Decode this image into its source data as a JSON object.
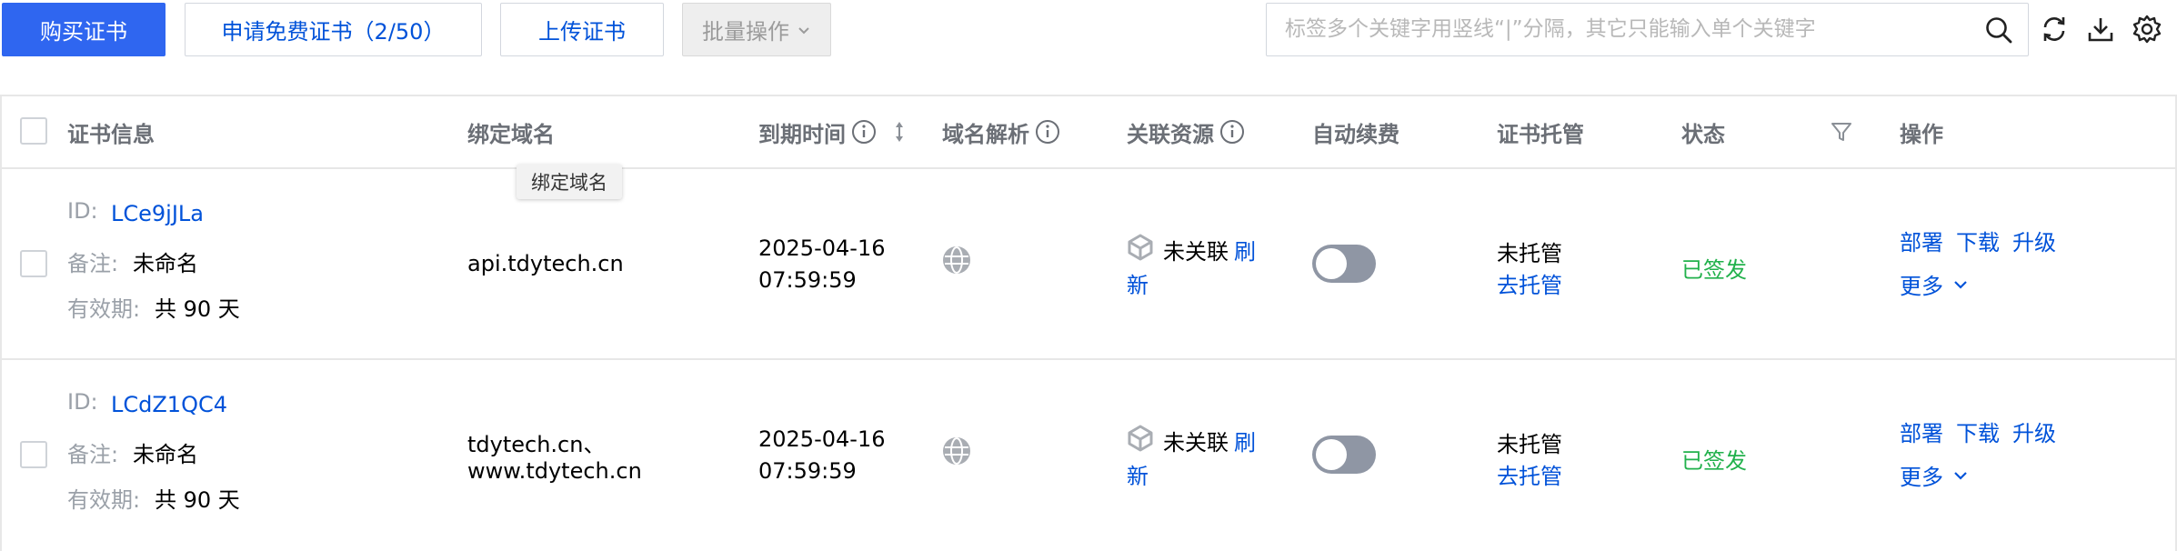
{
  "toolbar": {
    "buy_label": "购买证书",
    "apply_free_label": "申请免费证书（2/50）",
    "upload_label": "上传证书",
    "batch_label": "批量操作"
  },
  "search": {
    "placeholder": "标签多个关键字用竖线“|”分隔，其它只能输入单个关键字",
    "value": ""
  },
  "table": {
    "headers": {
      "cert_info": "证书信息",
      "domain": "绑定域名",
      "expiry": "到期时间",
      "dns": "域名解析",
      "resources": "关联资源",
      "auto_renew": "自动续费",
      "hosting": "证书托管",
      "status": "状态",
      "actions": "操作"
    },
    "tooltip": "绑定域名",
    "rows": [
      {
        "id_label": "ID:",
        "id": "LCe9jJLa",
        "note_label": "备注:",
        "note": "未命名",
        "validity_label": "有效期:",
        "validity": "共 90 天",
        "domain_line1": "api.tdytech.cn",
        "domain_line2": "",
        "expiry_date": "2025-04-16",
        "expiry_time": "07:59:59",
        "resource_status": "未关联",
        "refresh_a": "刷",
        "refresh_b": "新",
        "auto_renew": false,
        "hosting_status": "未托管",
        "hosting_action": "去托管",
        "status": "已签发",
        "action_deploy": "部署",
        "action_download": "下载",
        "action_upgrade": "升级",
        "action_more": "更多"
      },
      {
        "id_label": "ID:",
        "id": "LCdZ1QC4",
        "note_label": "备注:",
        "note": "未命名",
        "validity_label": "有效期:",
        "validity": "共 90 天",
        "domain_line1": "tdytech.cn、",
        "domain_line2": "www.tdytech.cn",
        "expiry_date": "2025-04-16",
        "expiry_time": "07:59:59",
        "resource_status": "未关联",
        "refresh_a": "刷",
        "refresh_b": "新",
        "auto_renew": false,
        "hosting_status": "未托管",
        "hosting_action": "去托管",
        "status": "已签发",
        "action_deploy": "部署",
        "action_download": "下载",
        "action_upgrade": "升级",
        "action_more": "更多"
      }
    ]
  },
  "colors": {
    "primary": "#2f66f0",
    "link": "#0052d9",
    "success": "#22b14c",
    "toggle_off": "#8f96a4"
  },
  "icons": [
    "chevron-down-icon",
    "search-icon",
    "refresh-icon",
    "download-icon",
    "settings-icon",
    "info-icon",
    "sort-icon",
    "filter-icon",
    "globe-icon",
    "resource-cube-icon"
  ]
}
